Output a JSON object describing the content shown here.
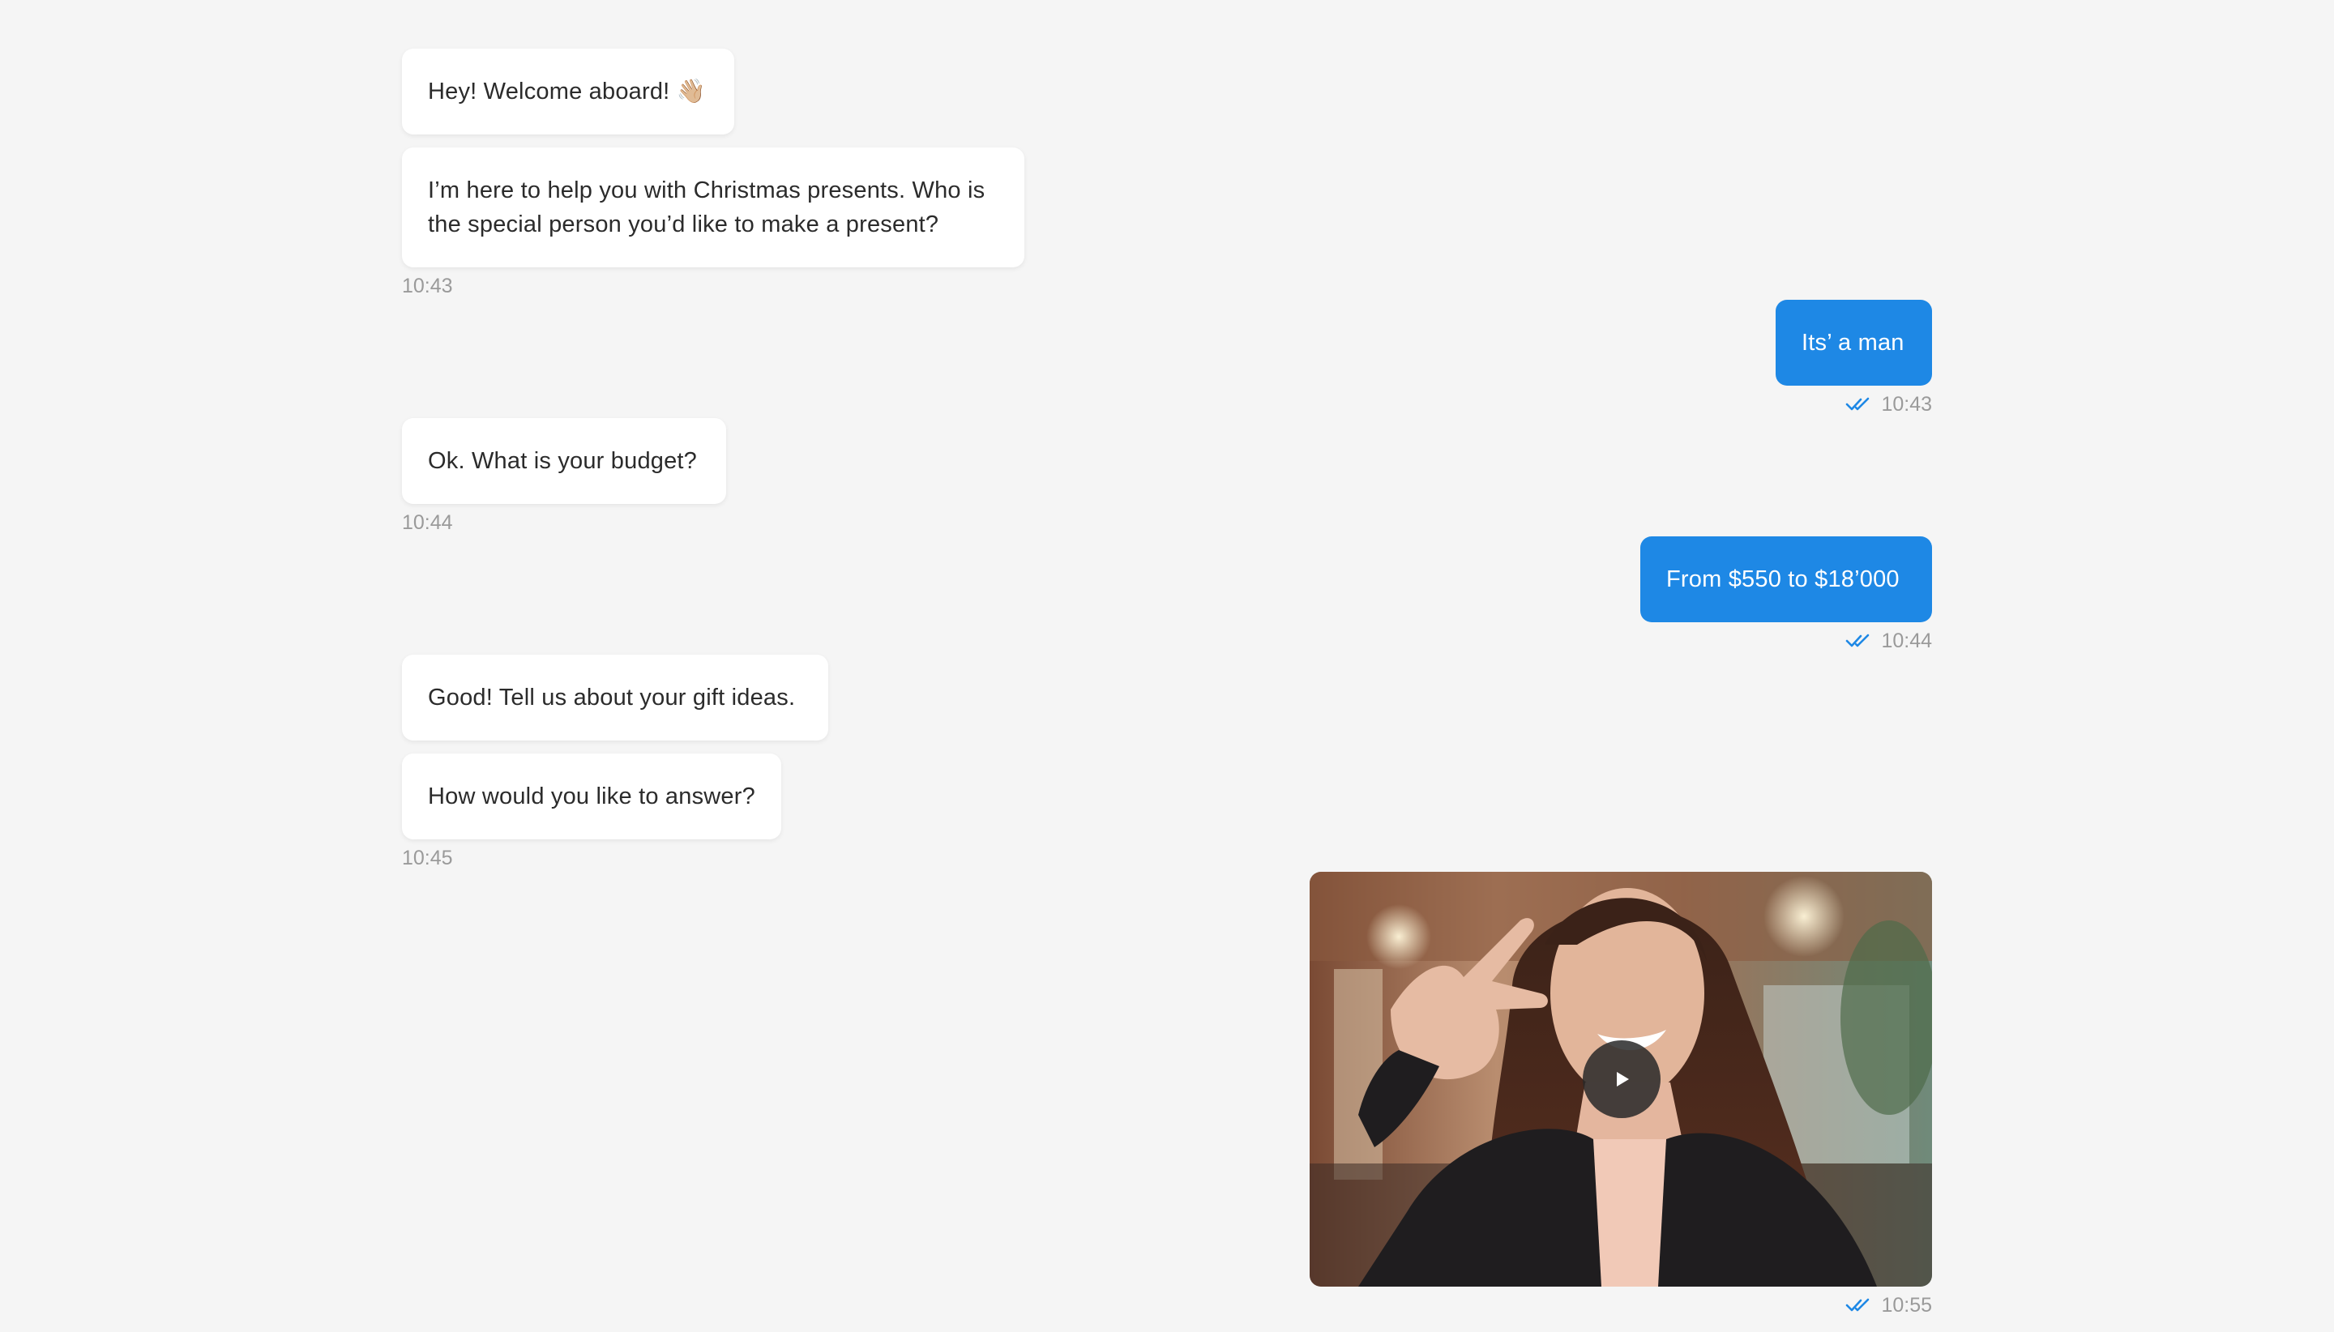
{
  "messages": {
    "m1": {
      "text": "Hey! Welcome aboard! 👋🏼"
    },
    "m2": {
      "line1": "I’m here to help you with Christmas presents. Who is",
      "line2": "the special person you’d like to make a present?"
    },
    "t1": "10:43",
    "m3": {
      "text": "Its’ a man"
    },
    "t2": "10:43",
    "m4": {
      "text": "Ok. What is your budget?"
    },
    "t3": "10:44",
    "m5": {
      "text": "From $550 to $18’000"
    },
    "t4": "10:44",
    "m6": {
      "text": "Good! Tell us about your gift ideas."
    },
    "m7": {
      "text": "How would you like to answer?"
    },
    "t5": "10:45",
    "t6": "10:55"
  },
  "icons": {
    "read_receipt": "double-check-icon",
    "play": "play-icon"
  },
  "colors": {
    "background": "#f5f5f5",
    "incoming_bubble": "#ffffff",
    "outgoing_bubble": "#1e88e5",
    "read_check": "#1e88e5",
    "timestamp": "#9a9a9a"
  }
}
